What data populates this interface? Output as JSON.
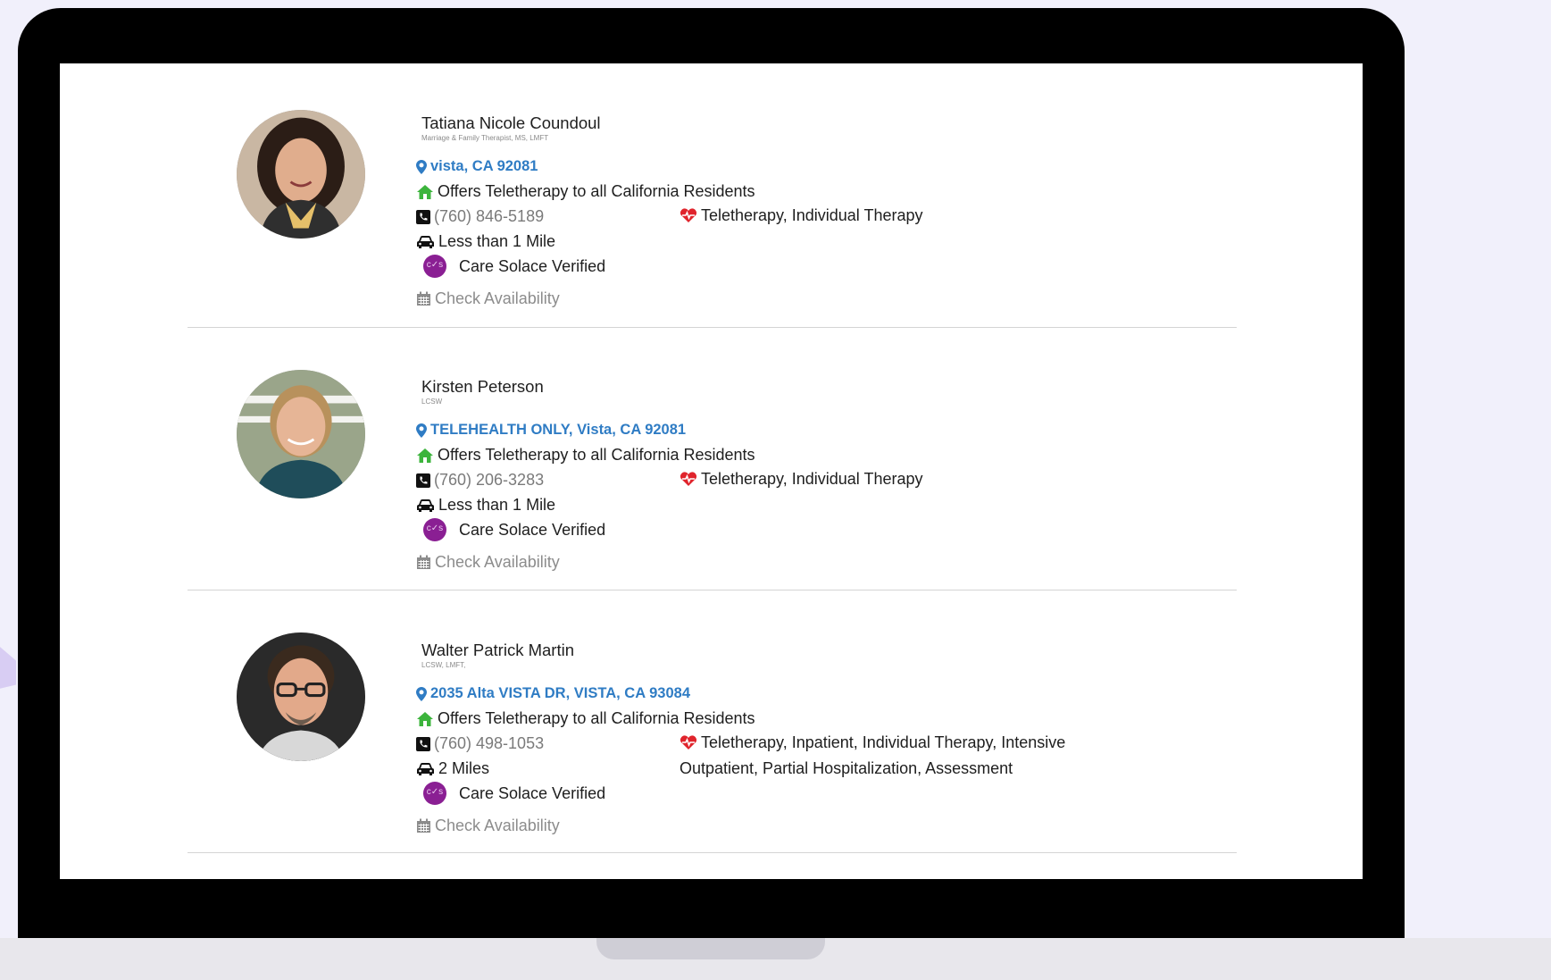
{
  "providers": [
    {
      "name": "Tatiana Nicole Coundoul",
      "credentials": "Marriage & Family Therapist, MS, LMFT",
      "location": "vista, CA 92081",
      "teletherapy": "Offers Teletherapy to all California Residents",
      "phone": "(760) 846-5189",
      "services": "Teletherapy, Individual Therapy",
      "distance": "Less than 1 Mile",
      "verified": "Care Solace Verified",
      "availability": "Check Availability"
    },
    {
      "name": "Kirsten Peterson",
      "credentials": "LCSW",
      "location": "TELEHEALTH ONLY, Vista, CA 92081",
      "teletherapy": "Offers Teletherapy to all California Residents",
      "phone": "(760) 206-3283",
      "services": "Teletherapy, Individual Therapy",
      "distance": "Less than 1 Mile",
      "verified": "Care Solace Verified",
      "availability": "Check Availability"
    },
    {
      "name": "Walter Patrick Martin",
      "credentials": "LCSW, LMFT,",
      "location": "2035 Alta VISTA DR, VISTA, CA 93084",
      "teletherapy": "Offers Teletherapy to all California Residents",
      "phone": "(760) 498-1053",
      "services": "Teletherapy, Inpatient, Individual Therapy, Intensive Outpatient, Partial Hospitalization, Assessment",
      "distance": "2 Miles",
      "verified": "Care Solace Verified",
      "availability": "Check Availability"
    }
  ],
  "badge_text": "c✓s",
  "colors": {
    "link": "#2f7cc4",
    "home_icon": "#3cb43c",
    "heart_icon": "#e0242c",
    "badge": "#8a1f93"
  },
  "icons": [
    "map-marker-icon",
    "home-icon",
    "phone-icon",
    "heartbeat-icon",
    "car-icon",
    "care-solace-badge-icon",
    "calendar-icon"
  ]
}
